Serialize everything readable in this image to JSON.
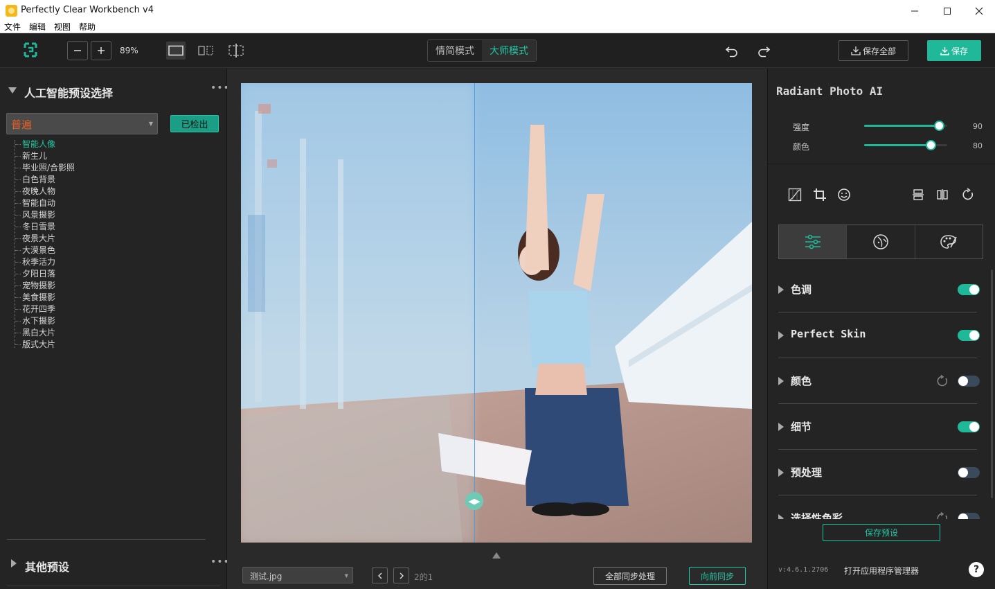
{
  "window": {
    "title": "Perfectly Clear Workbench v4",
    "menu": [
      "文件",
      "编辑",
      "视图",
      "帮助"
    ]
  },
  "toolbar": {
    "zoom": "89%",
    "mode_simple": "情简模式",
    "mode_master": "大师模式",
    "save_all": "保存全部",
    "save": "保存"
  },
  "left_panel": {
    "title": "人工智能预设选择",
    "selected_category": "普遍",
    "checkout_label": "已检出",
    "presets": [
      "智能人像",
      "新生儿",
      "毕业照/合影照",
      "白色背景",
      "夜晚人物",
      "智能自动",
      "风景摄影",
      "冬日雪景",
      "夜景大片",
      "大漠景色",
      "秋季活力",
      "夕阳日落",
      "宠物摄影",
      "美食摄影",
      "花开四季",
      "水下摄影",
      "黑白大片",
      "版式大片"
    ],
    "other_presets": "其他预设"
  },
  "canvas": {
    "file_name": "测试.jpg",
    "page_indicator": "2的1",
    "sync_all": "全部同步处理",
    "sync_forward": "向前同步"
  },
  "right_panel": {
    "title": "Radiant Photo AI",
    "sliders": [
      {
        "label": "强度",
        "value": 90,
        "max": 100
      },
      {
        "label": "颜色",
        "value": 80,
        "max": 100
      }
    ],
    "sections": [
      {
        "label": "色调",
        "enabled": true,
        "reset": false
      },
      {
        "label": "Perfect Skin",
        "enabled": true,
        "reset": false
      },
      {
        "label": "颜色",
        "enabled": false,
        "reset": true
      },
      {
        "label": "细节",
        "enabled": true,
        "reset": false
      },
      {
        "label": "预处理",
        "enabled": false,
        "reset": false
      },
      {
        "label": "选择性色彩",
        "enabled": false,
        "reset": true
      }
    ],
    "save_preset": "保存预设",
    "version": "v:4.6.1.2706",
    "app_manager": "打开应用程序管理器",
    "help": "?"
  },
  "colors": {
    "accent": "#1fb99a",
    "warning_text": "#e4612a"
  }
}
